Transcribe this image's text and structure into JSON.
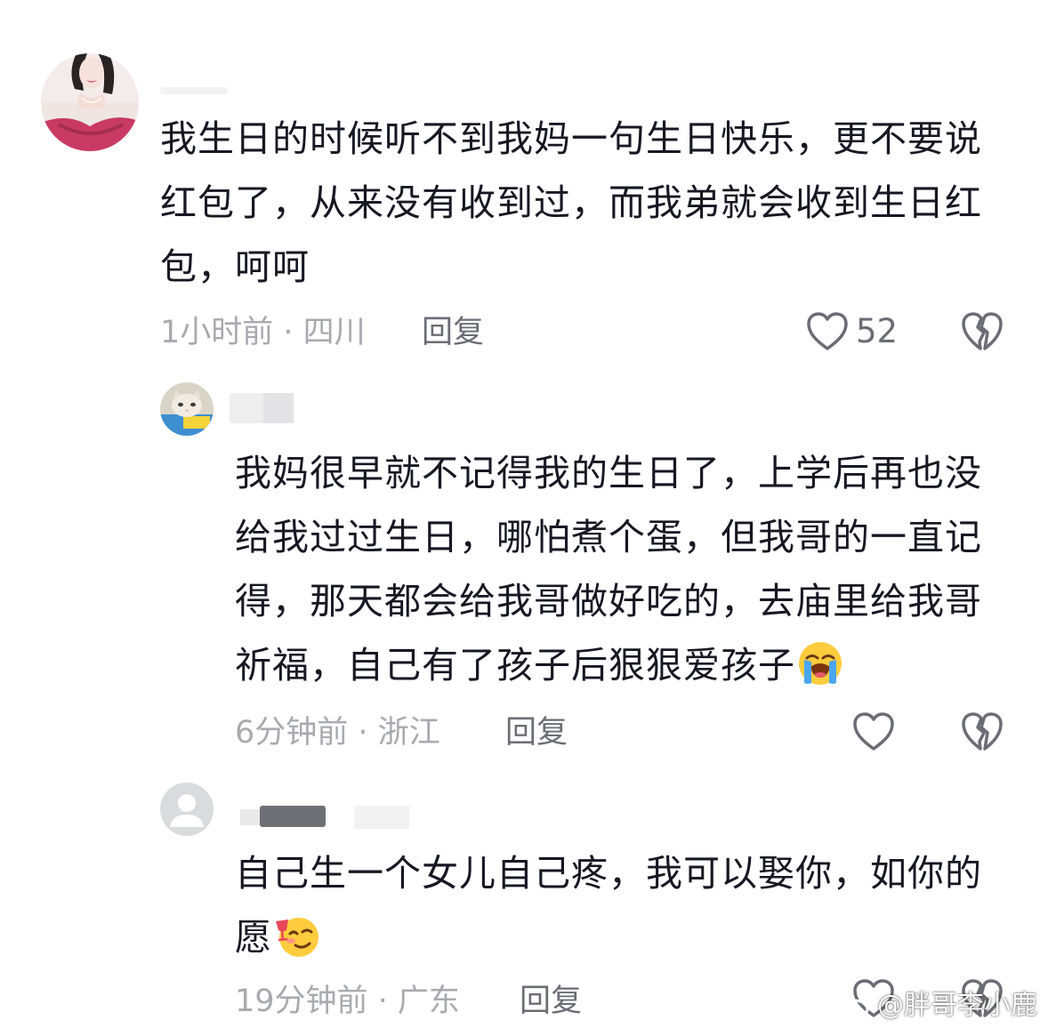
{
  "comments": [
    {
      "avatar": "woman-avatar",
      "text": "我生日的时候听不到我妈一句生日快乐，更不要说红包了，从来没有收到过，而我弟就会收到生日红包，呵呵",
      "time_location": "1小时前 · 四川",
      "reply_label": "回复",
      "like_count": "52"
    },
    {
      "avatar": "cat-avatar",
      "text": "我妈很早就不记得我的生日了，上学后再也没给我过过生日，哪怕煮个蛋，但我哥的一直记得，那天都会给我哥做好吃的，去庙里给我哥祈福，自己有了孩子后狠狠爱孩子",
      "emoji": "loudly-crying-face",
      "time_location": "6分钟前 · 浙江",
      "reply_label": "回复",
      "like_count": ""
    },
    {
      "avatar": "default-user-avatar",
      "text": "自己生一个女儿自己疼，我可以娶你，如你的愿",
      "emoji": "toasting-face",
      "time_location": "19分钟前 · 广东",
      "reply_label": "回复",
      "like_count": ""
    }
  ],
  "icons": {
    "like": "heart-outline-icon",
    "dislike": "broken-heart-icon"
  },
  "watermark": {
    "logo": "weibo-logo",
    "text": "@胖哥李小鹿"
  },
  "colors": {
    "text_primary": "#161823",
    "text_meta": "#a9aab0",
    "text_reply": "#6b6d75",
    "icon_stroke": "#6b6d75"
  }
}
